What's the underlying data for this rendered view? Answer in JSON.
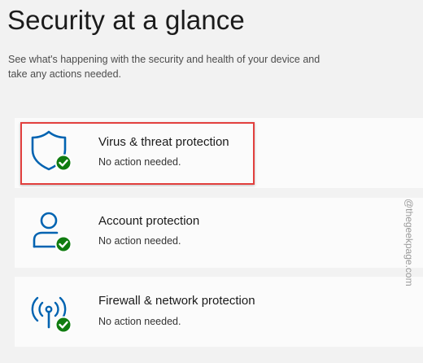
{
  "header": {
    "title": "Security at a glance",
    "subtitle": "See what's happening with the security and health of your device and take any actions needed."
  },
  "cards": [
    {
      "title": "Virus & threat protection",
      "status": "No action needed.",
      "icon": "shield-icon"
    },
    {
      "title": "Account protection",
      "status": "No action needed.",
      "icon": "person-icon"
    },
    {
      "title": "Firewall & network protection",
      "status": "No action needed.",
      "icon": "antenna-icon"
    }
  ],
  "watermark": "@thegeekpage.com",
  "colors": {
    "accent": "#0063b1",
    "ok_badge": "#107c10",
    "highlight": "#e2403e"
  }
}
